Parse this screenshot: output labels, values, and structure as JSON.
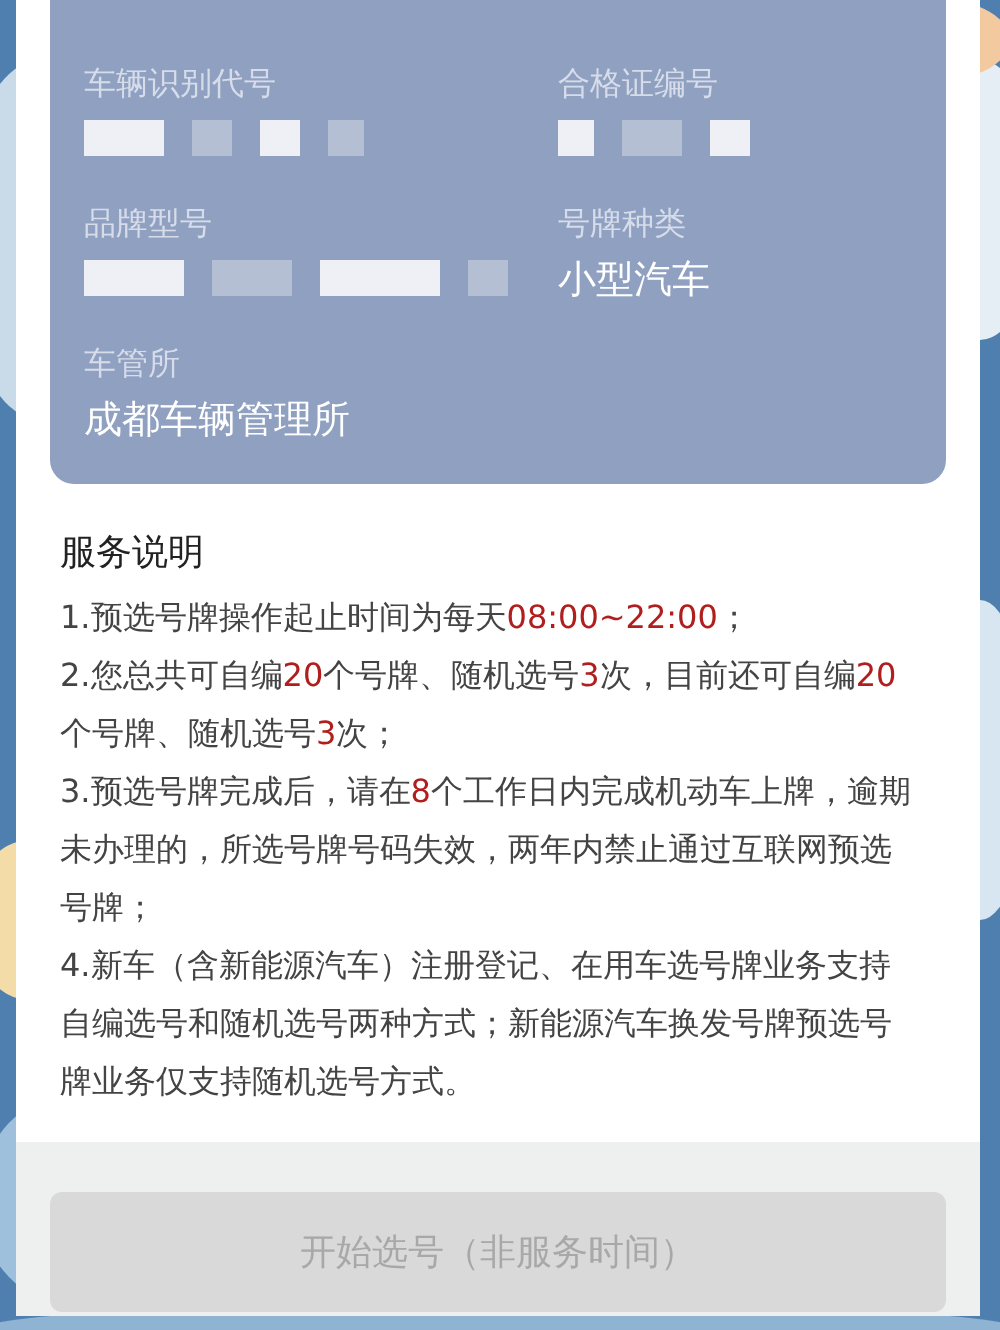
{
  "vehicle_info": {
    "fields": [
      {
        "label": "车辆识别代号",
        "value_redacted": true
      },
      {
        "label": "合格证编号",
        "value_redacted": true
      },
      {
        "label": "品牌型号",
        "value_redacted": true
      },
      {
        "label": "号牌种类",
        "value": "小型汽车"
      },
      {
        "label": "车管所",
        "value": "成都车辆管理所"
      }
    ]
  },
  "service_notes": {
    "title": "服务说明",
    "items": [
      [
        {
          "text": "1.预选号牌操作起止时间为每天"
        },
        {
          "text": "08:00~22:00",
          "highlight": true
        },
        {
          "text": "；"
        }
      ],
      [
        {
          "text": "2.您总共可自编"
        },
        {
          "text": "20",
          "highlight": true
        },
        {
          "text": "个号牌、随机选号"
        },
        {
          "text": "3",
          "highlight": true
        },
        {
          "text": "次，目前还可自编"
        },
        {
          "text": "20",
          "highlight": true
        },
        {
          "text": "个号牌、随机选号"
        },
        {
          "text": "3",
          "highlight": true
        },
        {
          "text": "次；"
        }
      ],
      [
        {
          "text": "3.预选号牌完成后，请在"
        },
        {
          "text": "8",
          "highlight": true
        },
        {
          "text": "个工作日内完成机动车上牌，逾期未办理的，所选号牌号码失效，两年内禁止通过互联网预选号牌；"
        }
      ],
      [
        {
          "text": "4.新车（含新能源汽车）注册登记、在用车选号牌业务支持自编选号和随机选号两种方式；新能源汽车换发号牌预选号牌业务仅支持随机选号方式。"
        }
      ]
    ]
  },
  "start_button": {
    "label": "开始选号（非服务时间）",
    "disabled": true
  }
}
